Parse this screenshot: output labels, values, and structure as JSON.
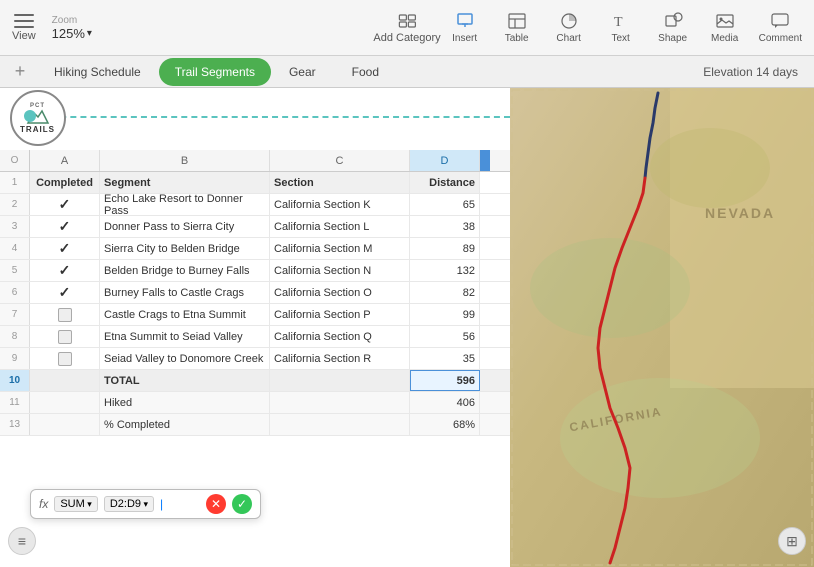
{
  "toolbar": {
    "view_label": "View",
    "zoom_label": "Zoom",
    "zoom_value": "125%",
    "add_category_label": "Add Category",
    "insert_label": "Insert",
    "table_label": "Table",
    "chart_label": "Chart",
    "text_label": "Text",
    "shape_label": "Shape",
    "media_label": "Media",
    "comment_label": "Comment"
  },
  "tabs": {
    "add_label": "+",
    "hiking_schedule": "Hiking Schedule",
    "trail_segments": "Trail Segments",
    "gear": "Gear",
    "food": "Food",
    "elevation": "Elevation 14 days"
  },
  "columns": {
    "row_indicator": "O",
    "a": "A",
    "b": "B",
    "c": "C",
    "d": "D"
  },
  "headers": {
    "completed": "Completed",
    "segment": "Segment",
    "section": "Section",
    "distance": "Distance"
  },
  "rows": [
    {
      "num": "2",
      "completed": true,
      "segment": "Echo Lake Resort to Donner Pass",
      "section": "California Section K",
      "distance": "65"
    },
    {
      "num": "3",
      "completed": true,
      "segment": "Donner Pass to Sierra City",
      "section": "California Section L",
      "distance": "38"
    },
    {
      "num": "4",
      "completed": true,
      "segment": "Sierra City to Belden Bridge",
      "section": "California Section M",
      "distance": "89"
    },
    {
      "num": "5",
      "completed": true,
      "segment": "Belden Bridge to Burney Falls",
      "section": "California Section N",
      "distance": "132"
    },
    {
      "num": "6",
      "completed": true,
      "segment": "Burney Falls to Castle Crags",
      "section": "California Section O",
      "distance": "82"
    },
    {
      "num": "7",
      "completed": false,
      "segment": "Castle Crags to Etna Summit",
      "section": "California Section P",
      "distance": "99"
    },
    {
      "num": "8",
      "completed": false,
      "segment": "Etna Summit to Seiad Valley",
      "section": "California Section Q",
      "distance": "56"
    },
    {
      "num": "9",
      "completed": false,
      "segment": "Seiad Valley to Donomore Creek",
      "section": "California Section R",
      "distance": "35"
    }
  ],
  "totals": {
    "total_label": "TOTAL",
    "total_value": "596",
    "hiked_label": "Hiked",
    "hiked_value": "406",
    "pct_label": "% Completed",
    "pct_value": "68%"
  },
  "formula": {
    "fx": "fx",
    "func": "SUM",
    "range": "D2:D9",
    "cursor": "|",
    "cancel": "✕",
    "confirm": "✓"
  },
  "map": {
    "nevada_label": "NEVADA",
    "california_label": "CALIFORNIA"
  }
}
